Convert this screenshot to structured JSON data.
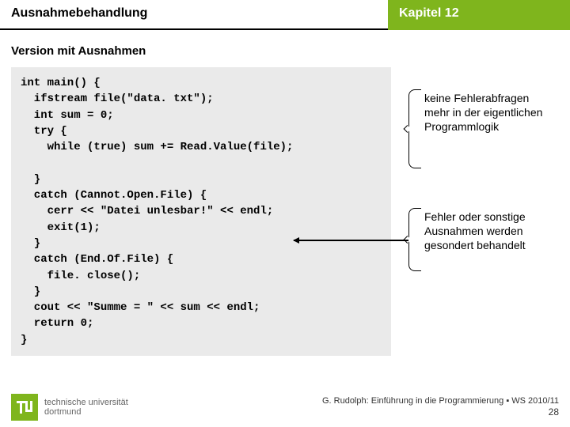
{
  "header": {
    "left": "Ausnahmebehandlung",
    "right": "Kapitel 12"
  },
  "section_title": "Version mit Ausnahmen",
  "code": "int main() {\n  ifstream file(\"data. txt\");\n  int sum = 0;\n  try {\n    while (true) sum += Read.Value(file);\n\n  }\n  catch (Cannot.Open.File) {\n    cerr << \"Datei unlesbar!\" << endl;\n    exit(1);\n  }\n  catch (End.Of.File) {\n    file. close();\n  }\n  cout << \"Summe = \" << sum << endl;\n  return 0;\n}",
  "notes": {
    "n1": "keine Fehlerabfragen mehr in der eigentlichen Programmlogik",
    "n2": "Fehler oder sonstige Ausnahmen werden gesondert behandelt"
  },
  "footer": {
    "uni_line1": "technische universität",
    "uni_line2": "dortmund",
    "credit": "G. Rudolph: Einführung in die Programmierung ▪ WS 2010/11",
    "page": "28"
  }
}
